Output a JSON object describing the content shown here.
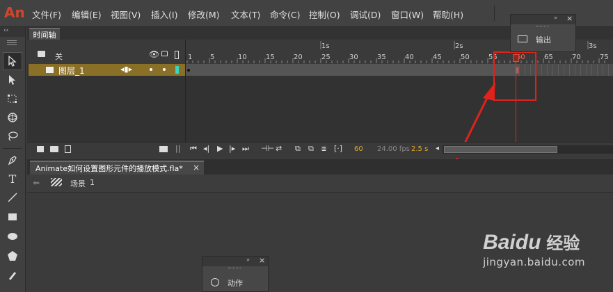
{
  "app": {
    "logo": "An"
  },
  "menu": [
    "文件(F)",
    "编辑(E)",
    "视图(V)",
    "插入(I)",
    "修改(M)",
    "文本(T)",
    "命令(C)",
    "控制(O)",
    "调试(D)",
    "窗口(W)",
    "帮助(H)"
  ],
  "timeline": {
    "tab": "时间轴",
    "header_label": "关",
    "layer_name": "图层_1",
    "ruler_numbers": [
      "1",
      "5",
      "10",
      "15",
      "20",
      "25",
      "30",
      "35",
      "40",
      "45",
      "50",
      "55",
      "60",
      "65",
      "70",
      "75"
    ],
    "ruler_seconds": [
      "1s",
      "2s",
      "3s"
    ],
    "current_frame": "60",
    "fps": "24.00 fps",
    "time": "2.5 s"
  },
  "output_panel": {
    "label": "输出",
    "icon": "monitor-icon"
  },
  "document": {
    "tab": "Animate如何设置图形元件的播放模式.fla*",
    "close": "×",
    "scene_label": "场景",
    "scene_number": "1"
  },
  "action_panel": {
    "label": "动作",
    "icon": "compass-icon"
  },
  "watermark": {
    "brand_en": "Baidu",
    "brand_cn": "经验",
    "url": "jingyan.baidu.com"
  },
  "colors": {
    "accent": "#d1452d",
    "highlight_box": "#e0221c",
    "layer_row": "#8a6f27",
    "playhead": "#c0392b"
  }
}
